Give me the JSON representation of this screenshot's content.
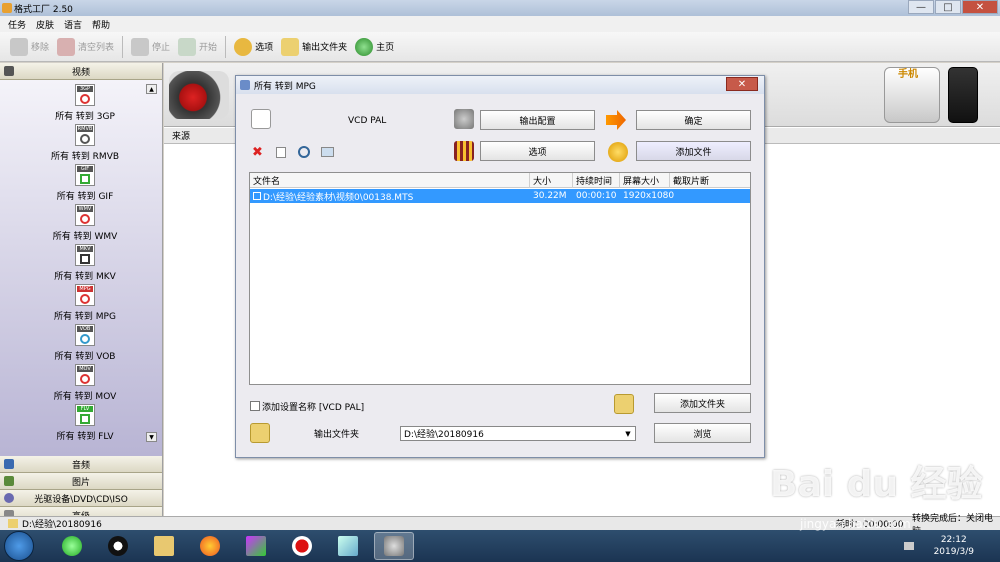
{
  "app": {
    "title": "格式工厂 2.50",
    "menu": [
      "任务",
      "皮肤",
      "语言",
      "帮助"
    ],
    "toolbar": [
      {
        "label": "移除",
        "enabled": false,
        "icon": "remove-icon"
      },
      {
        "label": "清空列表",
        "enabled": false,
        "icon": "clear-list-icon"
      },
      {
        "label": "停止",
        "enabled": false,
        "icon": "stop-icon"
      },
      {
        "label": "开始",
        "enabled": false,
        "icon": "start-icon"
      },
      {
        "label": "选项",
        "enabled": true,
        "icon": "options-icon"
      },
      {
        "label": "输出文件夹",
        "enabled": true,
        "icon": "folder-icon"
      },
      {
        "label": "主页",
        "enabled": true,
        "icon": "home-globe-icon"
      }
    ]
  },
  "sidebar": {
    "video_header": "视频",
    "formats": [
      {
        "badge": "3GP",
        "label": "所有 转到 3GP"
      },
      {
        "badge": "RMVB",
        "label": "所有 转到 RMVB"
      },
      {
        "badge": "GIF",
        "label": "所有 转到 GIF"
      },
      {
        "badge": "WMV",
        "label": "所有 转到 WMV"
      },
      {
        "badge": "MKV",
        "label": "所有 转到 MKV"
      },
      {
        "badge": "MPG",
        "label": "所有 转到 MPG"
      },
      {
        "badge": "VOB",
        "label": "所有 转到 VOB"
      },
      {
        "badge": "MOV",
        "label": "所有 转到 MOV"
      },
      {
        "badge": "FLV",
        "label": "所有 转到 FLV"
      }
    ],
    "categories": [
      "音频",
      "图片",
      "光驱设备\\DVD\\CD\\ISO",
      "高级"
    ]
  },
  "main": {
    "source_header": "来源",
    "banner_label": "手机"
  },
  "dialog": {
    "title": "所有 转到 MPG",
    "preset": "VCD PAL",
    "output_config_button": "输出配置",
    "ok_button": "确定",
    "options_button": "选项",
    "add_file_button": "添加文件",
    "columns": [
      "文件名",
      "大小",
      "持续时间",
      "屏幕大小",
      "截取片断"
    ],
    "rows": [
      {
        "name": "D:\\经验\\经验素材\\视频0\\00138.MTS",
        "size": "30.22M",
        "duration": "00:00:10",
        "screen": "1920x1080",
        "clip": ""
      }
    ],
    "add_setting_name_label": "添加设置名称 [VCD PAL]",
    "add_folder_button": "添加文件夹",
    "output_folder_label": "输出文件夹",
    "output_folder_value": "D:\\经验\\20180916",
    "browse_button": "浏览"
  },
  "statusbar": {
    "path": "D:\\经验\\20180916",
    "elapsed": "耗时：00:00:00",
    "after_done": "转换完成后：关闭电脑"
  },
  "taskbar": {
    "time": "22:12",
    "date": "2019/3/9"
  },
  "watermark": {
    "logo": "Bai du 经验",
    "url": "jingyan.baidu.com"
  },
  "colors": {
    "selection": "#3399ff",
    "close_button": "#c75a4a",
    "sidebar_gradient_end": "#b8b4d4"
  }
}
